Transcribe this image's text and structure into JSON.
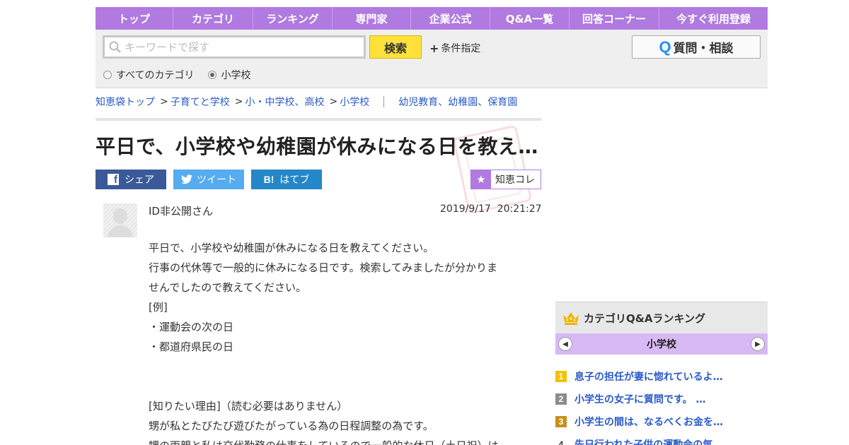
{
  "nav": {
    "items": [
      "トップ",
      "カテゴリ",
      "ランキング",
      "専門家",
      "企業公式",
      "Q&A一覧",
      "回答コーナー",
      "今すぐ利用登録"
    ]
  },
  "search": {
    "placeholder": "キーワードで探す",
    "button": "検索",
    "conditions": "条件指定",
    "scope_all": "すべてのカテゴリ",
    "scope_current": "小学校",
    "ask_button": "質問・相談",
    "ask_icon_letter": "Q"
  },
  "breadcrumb": {
    "items": [
      "知恵袋トップ",
      "子育てと学校",
      "小・中学校、高校",
      "小学校"
    ],
    "related": "幼児教育、幼稚園、保育園"
  },
  "question": {
    "title": "平日で、小学校や幼稚園が休みになる日を教え…",
    "user": "ID非公開さん",
    "date": "2019/9/17  20:21:27",
    "body": [
      "平日で、小学校や幼稚園が休みになる日を教えてください。",
      "行事の代休等で一般的に休みになる日です。検索してみましたが分かりま",
      "せんでしたので教えてください。",
      "[例]",
      "・運動会の次の日",
      "・都道府県民の日",
      "",
      "",
      "[知りたい理由]（読む必要はありません）",
      "甥が私とたびたび遊びたがっている為の日程調整の為です。",
      "甥の両親と私は交代勤務の仕事をしているので一般的な休日（土日祝）は"
    ]
  },
  "share": {
    "facebook": "シェア",
    "facebook_icon": "f",
    "twitter": "ツイート",
    "hatena": "はてブ",
    "hatena_icon": "B!",
    "chiekore": "知恵コレ"
  },
  "ranking": {
    "title": "カテゴリQ&Aランキング",
    "category": "小学校",
    "items": [
      {
        "rank": "1",
        "text": "息子の担任が妻に惚れているよ…"
      },
      {
        "rank": "2",
        "text": "小学生の女子に質問です。 …"
      },
      {
        "rank": "3",
        "text": "小学生の間は、なるべくお金を…"
      },
      {
        "rank": "4",
        "text": "先日行われた子供の運動会の気…"
      }
    ]
  },
  "colors": {
    "nav_bg": "#b07ae0",
    "search_button": "#ffe13b",
    "link": "#2a5bc8",
    "facebook": "#3b5998",
    "twitter": "#55acee",
    "hatena": "#2487c8"
  }
}
